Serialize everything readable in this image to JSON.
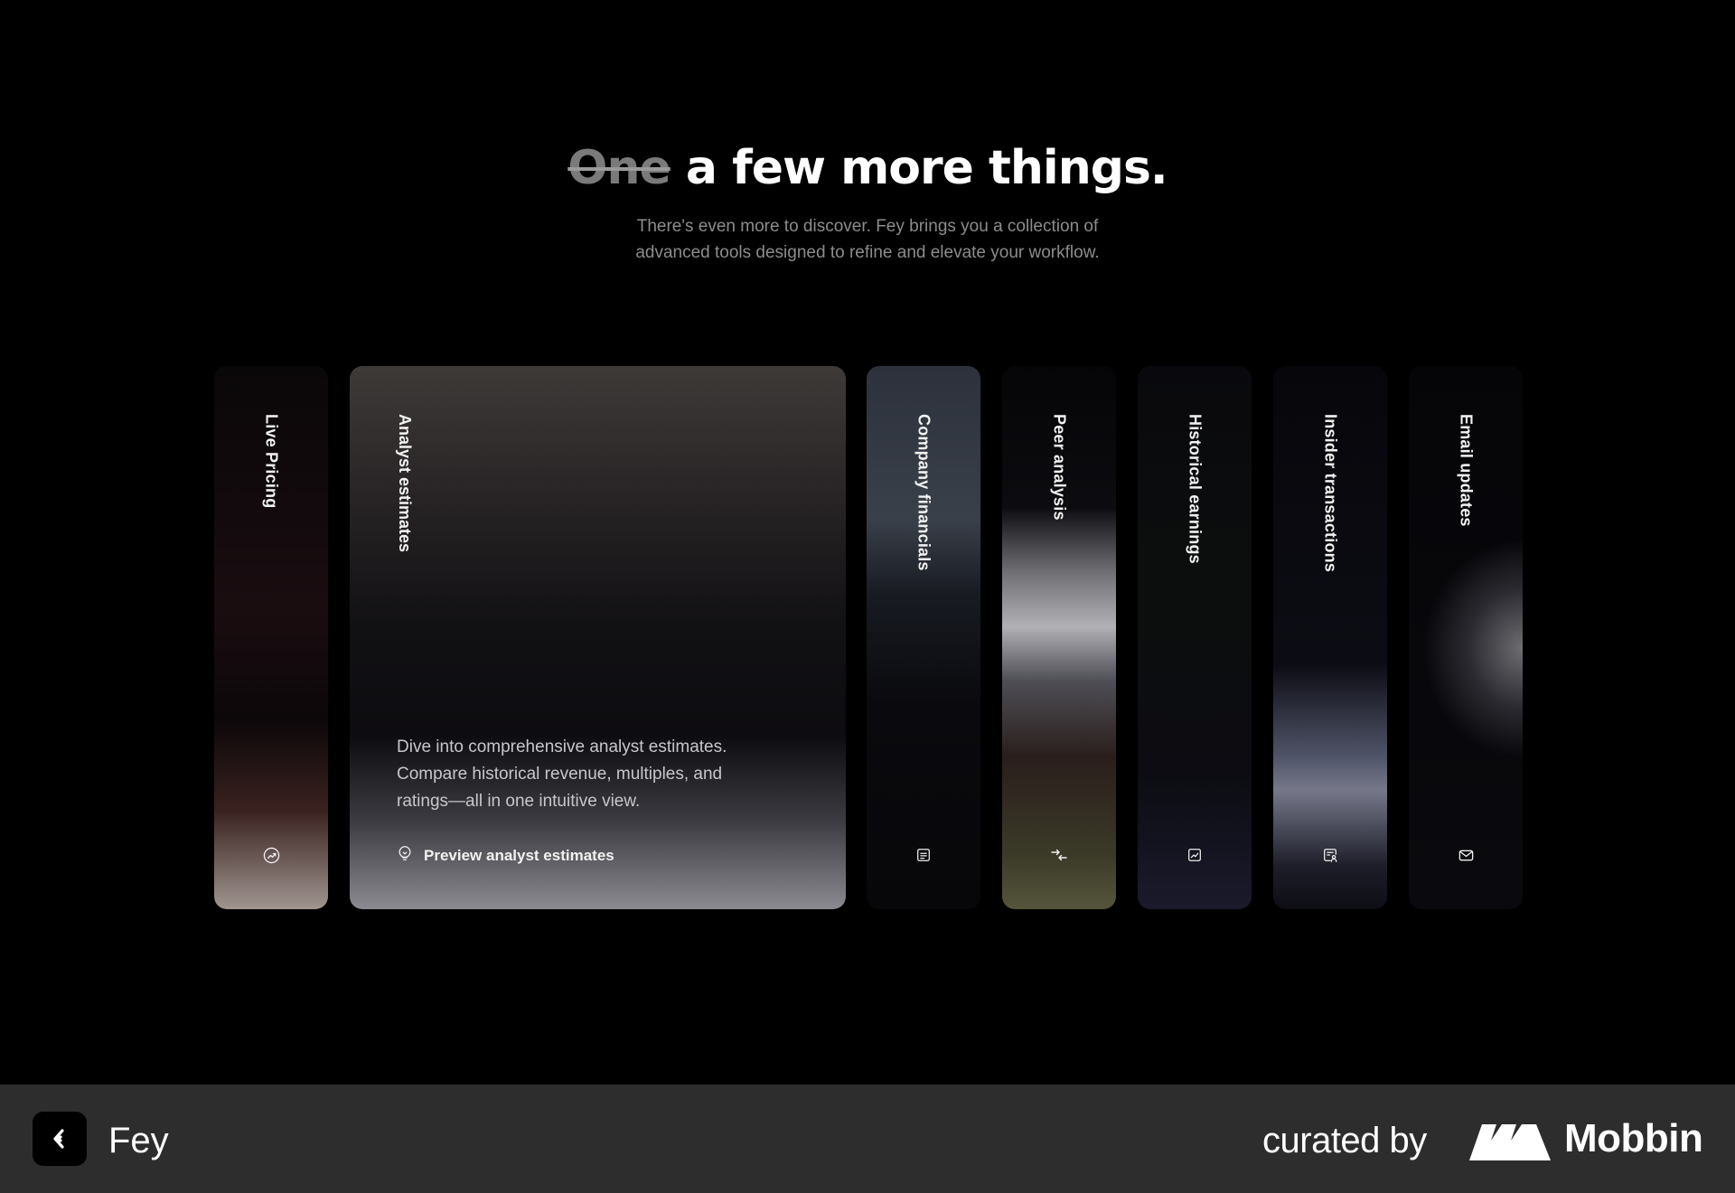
{
  "hero": {
    "headline_struck": "One",
    "headline_rest": "a few more things.",
    "subtitle_line1": "There's even more to discover. Fey brings you a collection of",
    "subtitle_line2": "advanced tools designed to refine and elevate your workflow."
  },
  "cards": [
    {
      "label": "Live Pricing",
      "icon": "trend-up-circle-icon"
    },
    {
      "label": "Analyst estimates",
      "icon": "bulb-icon",
      "expanded": true,
      "description": "Dive into comprehensive analyst estimates. Compare historical revenue, multiples, and ratings—all in one intuitive view.",
      "cta_label": "Preview analyst estimates"
    },
    {
      "label": "Company financials",
      "icon": "document-icon"
    },
    {
      "label": "Peer analysis",
      "icon": "arrows-compare-icon"
    },
    {
      "label": "Historical earnings",
      "icon": "chart-box-icon"
    },
    {
      "label": "Insider transactions",
      "icon": "person-document-icon"
    },
    {
      "label": "Email updates",
      "icon": "mail-icon"
    }
  ],
  "footer": {
    "app_name": "Fey",
    "curated_by": "curated by",
    "brand": "Mobbin"
  },
  "colors": {
    "background": "#000000",
    "footer_background": "#2d2d2d",
    "subtitle": "#8c8c8c"
  }
}
